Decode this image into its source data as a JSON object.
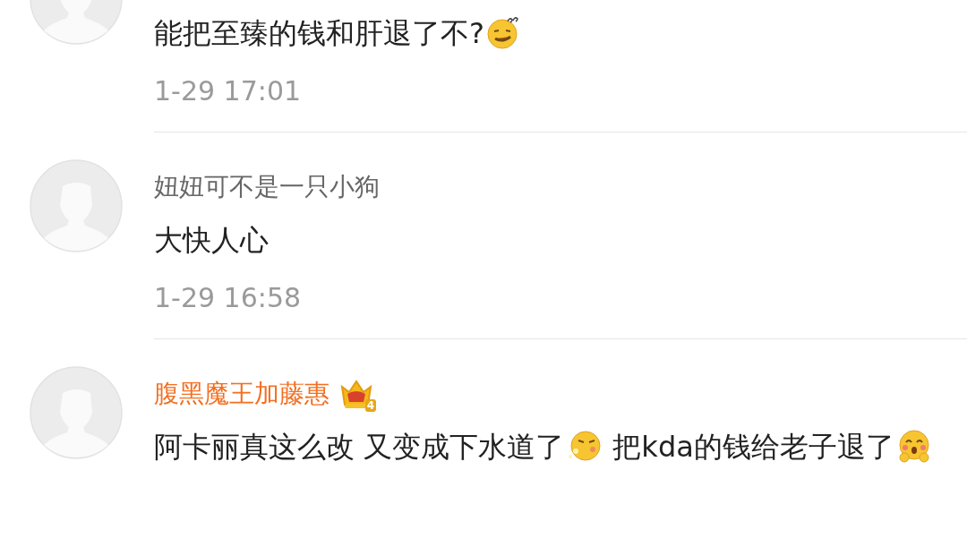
{
  "comments": [
    {
      "body": [
        {
          "kind": "text",
          "text": "能把至臻的钱和肝退了不?"
        },
        {
          "kind": "confused"
        }
      ],
      "time": "1-29 17:01"
    },
    {
      "name": "妞妞可不是一只小狗",
      "highlighted": false,
      "body": [
        {
          "kind": "text",
          "text": "大快人心"
        }
      ],
      "time": "1-29 16:58"
    },
    {
      "name": "腹黑魔王加藤惠",
      "highlighted": true,
      "badge": "4",
      "body": [
        {
          "kind": "text",
          "text": "阿卡丽真这么改 又变成下水道了"
        },
        {
          "kind": "puffing"
        },
        {
          "kind": "text",
          "text": " 把kda的钱给老子退了"
        },
        {
          "kind": "blushing"
        }
      ]
    }
  ]
}
